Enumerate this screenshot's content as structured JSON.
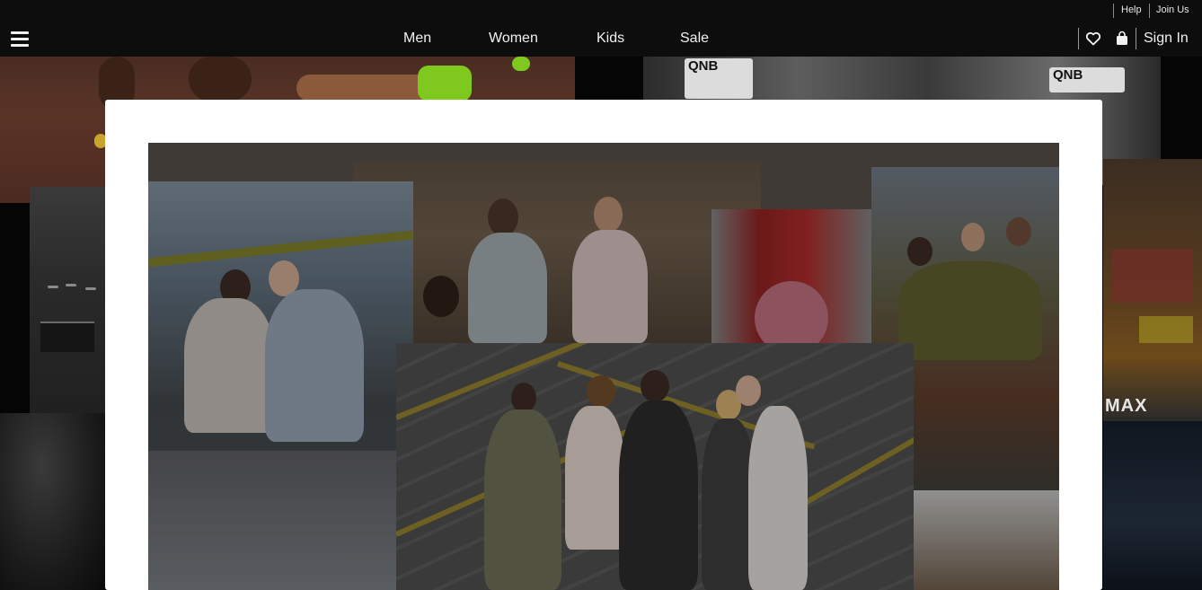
{
  "utility_bar": {
    "help_label": "Help",
    "join_label": "Join Us"
  },
  "nav": {
    "menu_icon": "hamburger-menu-icon",
    "links": [
      {
        "label": "Men"
      },
      {
        "label": "Women"
      },
      {
        "label": "Kids"
      },
      {
        "label": "Sale"
      }
    ],
    "favorites_icon": "heart-icon",
    "bag_icon": "shopping-bag-icon",
    "sign_in_label": "Sign In"
  },
  "background": {
    "bib_labels": [
      "QNB",
      "QNB"
    ],
    "store_sign": "MAX"
  },
  "colors": {
    "nav_background": "#0d0d0d",
    "nav_text": "#f2f2f2",
    "modal_background": "#ffffff",
    "overlay": "#000000"
  }
}
